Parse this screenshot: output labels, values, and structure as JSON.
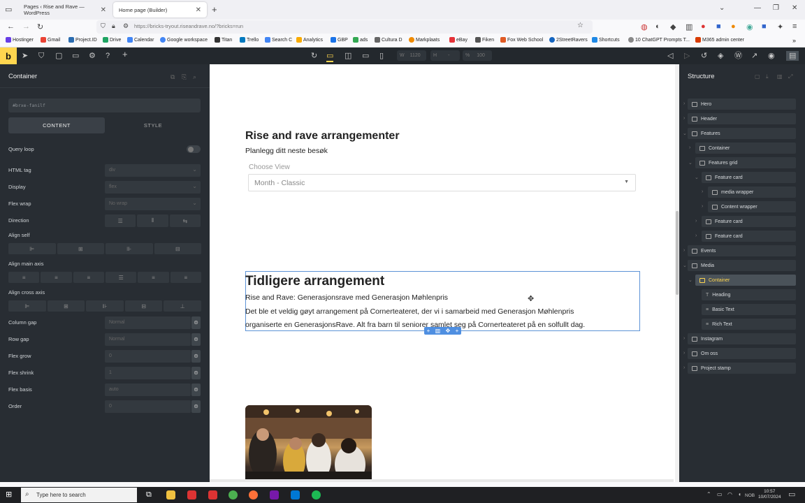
{
  "browser": {
    "tabs": [
      {
        "label": "Pages ‹ Rise and Rave — WordPress",
        "close": "✕"
      },
      {
        "label": "Home page (Builder)",
        "close": "✕"
      }
    ],
    "new_tab": "+",
    "url": "https://bricks-tryout.riseandrave.no/?bricks=run",
    "bookmarks": [
      "Hostinger",
      "Gmail",
      "Project.ID",
      "Drive",
      "Calendar",
      "Google workspace",
      "Titan",
      "Trello",
      "Search C",
      "Analytics",
      "GBP",
      "ads",
      "Cultura D",
      "Markplaats",
      "eBay",
      "Fiken",
      "Fox Web School",
      "2StreetRavers",
      "Shortcuts",
      "10 ChatGPT Prompts T...",
      "M365 admin center"
    ]
  },
  "builder": {
    "logo": "b",
    "width_label": "W",
    "width_value": "1120",
    "height_label": "H",
    "height_value": "-",
    "zoom_label": "%",
    "zoom_value": "100"
  },
  "left_panel": {
    "title": "Container",
    "css_id": "#brxe-fanilf",
    "tabs": [
      "CONTENT",
      "STYLE"
    ],
    "query_loop": "Query loop",
    "fields": [
      {
        "label": "HTML tag",
        "value": "div"
      },
      {
        "label": "Display",
        "value": "flex"
      },
      {
        "label": "Flex wrap",
        "value": "No wrap"
      }
    ],
    "direction": "Direction",
    "align_self": "Align self",
    "align_main": "Align main axis",
    "align_cross": "Align cross axis",
    "inputs": [
      {
        "label": "Column gap",
        "value": "Normal"
      },
      {
        "label": "Row gap",
        "value": "Normal"
      },
      {
        "label": "Flex grow",
        "value": "0"
      },
      {
        "label": "Flex shrink",
        "value": "1"
      },
      {
        "label": "Flex basis",
        "value": "auto"
      },
      {
        "label": "Order",
        "value": "0"
      }
    ]
  },
  "canvas": {
    "h2_1": "Rise and rave arrangementer",
    "sub_1": "Planlegg ditt neste besøk",
    "choose_view": "Choose View",
    "view_select": "Month - Classic",
    "h2_2": "Tidligere arrangement",
    "sub_2": "Rise and Rave: Generasjonsrave med Generasjon Møhlenpris",
    "para_1": "Det ble et veldig gøyt arrangement på Cornerteateret, der vi i samarbeid med Generasjon Møhlenpris",
    "para_2": "organiserte en GenerasjonsRave. Alt fra barn til seniorer samlet seg på Cornerteateret på en solfullt dag."
  },
  "structure": {
    "title": "Structure",
    "items": [
      "Hero",
      "Header",
      "Features",
      "Container",
      "Features grid",
      "Feature card",
      "media wrapper",
      "Content wrapper",
      "Feature card",
      "Feature card",
      "Events",
      "Media",
      "Container",
      "Heading",
      "Basic Text",
      "Rich Text",
      "Instagram",
      "Om oss",
      "Project stamp"
    ]
  },
  "taskbar": {
    "search_placeholder": "Type here to search",
    "lang": "NOB",
    "time": "10:57",
    "date": "10/07/2024"
  }
}
